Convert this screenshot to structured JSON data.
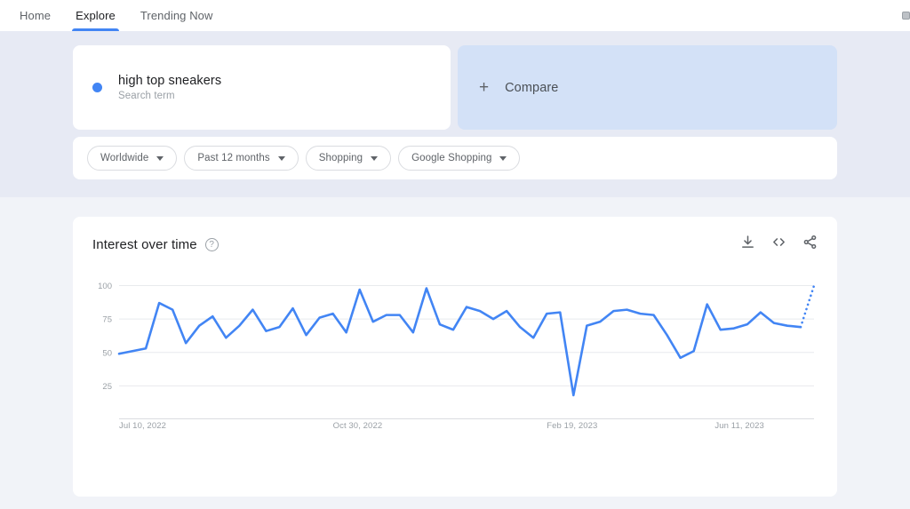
{
  "topbar": {
    "tabs": [
      {
        "label": "Home",
        "active": false
      },
      {
        "label": "Explore",
        "active": true
      },
      {
        "label": "Trending Now",
        "active": false
      }
    ],
    "corner_icon": "square-badge-icon"
  },
  "hero": {
    "term": {
      "title": "high top sneakers",
      "subtitle": "Search term",
      "dot_color": "#4285f4"
    },
    "compare": {
      "label": "Compare",
      "plus": "+",
      "background": "#d3e1f7"
    },
    "filters": [
      {
        "label": "Worldwide",
        "name": "location-filter"
      },
      {
        "label": "Past 12 months",
        "name": "time-range-filter"
      },
      {
        "label": "Shopping",
        "name": "category-filter"
      },
      {
        "label": "Google Shopping",
        "name": "search-type-filter"
      }
    ]
  },
  "chart_card": {
    "title": "Interest over time",
    "help_glyph": "?",
    "actions": [
      {
        "name": "download-icon",
        "label": "Download"
      },
      {
        "name": "embed-code-icon",
        "label": "Embed"
      },
      {
        "name": "share-icon",
        "label": "Share"
      }
    ]
  },
  "chart_data": {
    "type": "line",
    "title": "Interest over time",
    "xlabel": "",
    "ylabel": "",
    "ylim": [
      0,
      105
    ],
    "yticks": [
      25,
      50,
      75,
      100
    ],
    "grid": true,
    "legend": false,
    "line_color": "#4285f4",
    "series_name": "high top sneakers",
    "x_tick_labels": [
      "Jul 10, 2022",
      "Oct 30, 2022",
      "Feb 19, 2023",
      "Jun 11, 2023"
    ],
    "x_tick_indices": [
      0,
      16,
      32,
      48
    ],
    "partial_from_index": 51,
    "values": [
      49,
      51,
      53,
      87,
      82,
      57,
      70,
      77,
      61,
      70,
      82,
      66,
      69,
      83,
      63,
      76,
      79,
      65,
      97,
      73,
      78,
      78,
      65,
      98,
      71,
      67,
      84,
      81,
      75,
      81,
      69,
      61,
      79,
      80,
      18,
      70,
      73,
      81,
      82,
      79,
      78,
      63,
      46,
      51,
      86,
      67,
      68,
      71,
      80,
      72,
      70,
      69,
      100
    ]
  }
}
